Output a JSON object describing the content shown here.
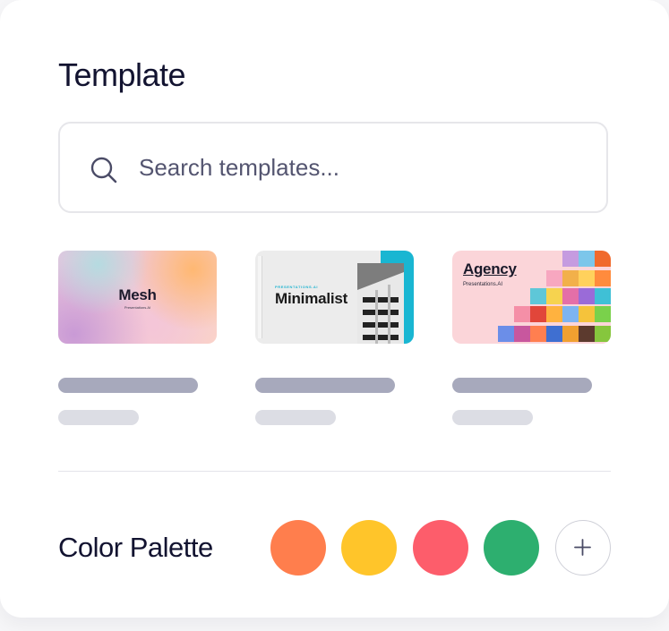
{
  "template": {
    "title": "Template",
    "search": {
      "placeholder": "Search templates...",
      "icon": "search-icon"
    },
    "cards": [
      {
        "name": "Mesh",
        "subtitle": "Presentations.AI"
      },
      {
        "name": "Minimalist",
        "subtitle": "PRESENTATIONS.AI"
      },
      {
        "name": "Agency",
        "subtitle": "Presentations.AI"
      }
    ]
  },
  "palette": {
    "label": "Color Palette",
    "colors": [
      "#FF7E4D",
      "#FFC52A",
      "#FD5D6B",
      "#2DAF6F"
    ],
    "add_icon": "plus-icon"
  }
}
